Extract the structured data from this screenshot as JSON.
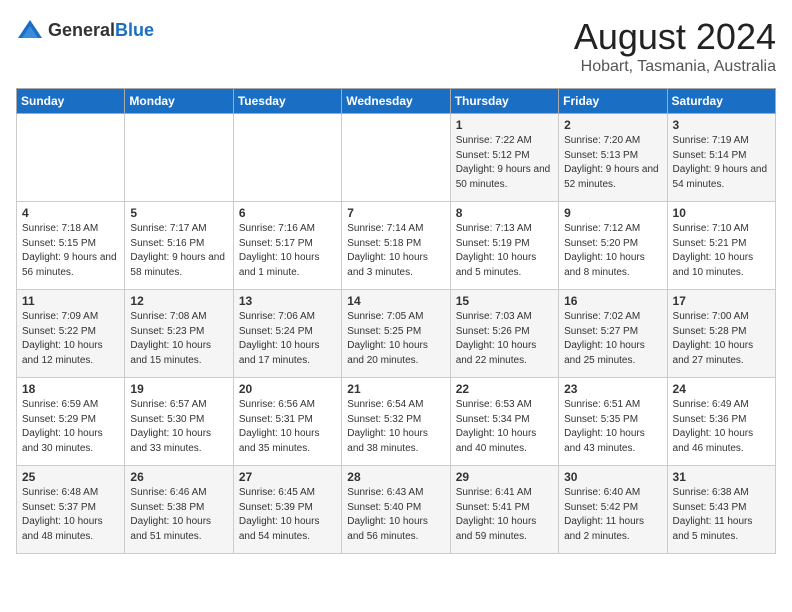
{
  "header": {
    "logo_general": "General",
    "logo_blue": "Blue",
    "title": "August 2024",
    "subtitle": "Hobart, Tasmania, Australia"
  },
  "weekdays": [
    "Sunday",
    "Monday",
    "Tuesday",
    "Wednesday",
    "Thursday",
    "Friday",
    "Saturday"
  ],
  "weeks": [
    [
      {
        "day": "",
        "sunrise": "",
        "sunset": "",
        "daylight": ""
      },
      {
        "day": "",
        "sunrise": "",
        "sunset": "",
        "daylight": ""
      },
      {
        "day": "",
        "sunrise": "",
        "sunset": "",
        "daylight": ""
      },
      {
        "day": "",
        "sunrise": "",
        "sunset": "",
        "daylight": ""
      },
      {
        "day": "1",
        "sunrise": "Sunrise: 7:22 AM",
        "sunset": "Sunset: 5:12 PM",
        "daylight": "Daylight: 9 hours and 50 minutes."
      },
      {
        "day": "2",
        "sunrise": "Sunrise: 7:20 AM",
        "sunset": "Sunset: 5:13 PM",
        "daylight": "Daylight: 9 hours and 52 minutes."
      },
      {
        "day": "3",
        "sunrise": "Sunrise: 7:19 AM",
        "sunset": "Sunset: 5:14 PM",
        "daylight": "Daylight: 9 hours and 54 minutes."
      }
    ],
    [
      {
        "day": "4",
        "sunrise": "Sunrise: 7:18 AM",
        "sunset": "Sunset: 5:15 PM",
        "daylight": "Daylight: 9 hours and 56 minutes."
      },
      {
        "day": "5",
        "sunrise": "Sunrise: 7:17 AM",
        "sunset": "Sunset: 5:16 PM",
        "daylight": "Daylight: 9 hours and 58 minutes."
      },
      {
        "day": "6",
        "sunrise": "Sunrise: 7:16 AM",
        "sunset": "Sunset: 5:17 PM",
        "daylight": "Daylight: 10 hours and 1 minute."
      },
      {
        "day": "7",
        "sunrise": "Sunrise: 7:14 AM",
        "sunset": "Sunset: 5:18 PM",
        "daylight": "Daylight: 10 hours and 3 minutes."
      },
      {
        "day": "8",
        "sunrise": "Sunrise: 7:13 AM",
        "sunset": "Sunset: 5:19 PM",
        "daylight": "Daylight: 10 hours and 5 minutes."
      },
      {
        "day": "9",
        "sunrise": "Sunrise: 7:12 AM",
        "sunset": "Sunset: 5:20 PM",
        "daylight": "Daylight: 10 hours and 8 minutes."
      },
      {
        "day": "10",
        "sunrise": "Sunrise: 7:10 AM",
        "sunset": "Sunset: 5:21 PM",
        "daylight": "Daylight: 10 hours and 10 minutes."
      }
    ],
    [
      {
        "day": "11",
        "sunrise": "Sunrise: 7:09 AM",
        "sunset": "Sunset: 5:22 PM",
        "daylight": "Daylight: 10 hours and 12 minutes."
      },
      {
        "day": "12",
        "sunrise": "Sunrise: 7:08 AM",
        "sunset": "Sunset: 5:23 PM",
        "daylight": "Daylight: 10 hours and 15 minutes."
      },
      {
        "day": "13",
        "sunrise": "Sunrise: 7:06 AM",
        "sunset": "Sunset: 5:24 PM",
        "daylight": "Daylight: 10 hours and 17 minutes."
      },
      {
        "day": "14",
        "sunrise": "Sunrise: 7:05 AM",
        "sunset": "Sunset: 5:25 PM",
        "daylight": "Daylight: 10 hours and 20 minutes."
      },
      {
        "day": "15",
        "sunrise": "Sunrise: 7:03 AM",
        "sunset": "Sunset: 5:26 PM",
        "daylight": "Daylight: 10 hours and 22 minutes."
      },
      {
        "day": "16",
        "sunrise": "Sunrise: 7:02 AM",
        "sunset": "Sunset: 5:27 PM",
        "daylight": "Daylight: 10 hours and 25 minutes."
      },
      {
        "day": "17",
        "sunrise": "Sunrise: 7:00 AM",
        "sunset": "Sunset: 5:28 PM",
        "daylight": "Daylight: 10 hours and 27 minutes."
      }
    ],
    [
      {
        "day": "18",
        "sunrise": "Sunrise: 6:59 AM",
        "sunset": "Sunset: 5:29 PM",
        "daylight": "Daylight: 10 hours and 30 minutes."
      },
      {
        "day": "19",
        "sunrise": "Sunrise: 6:57 AM",
        "sunset": "Sunset: 5:30 PM",
        "daylight": "Daylight: 10 hours and 33 minutes."
      },
      {
        "day": "20",
        "sunrise": "Sunrise: 6:56 AM",
        "sunset": "Sunset: 5:31 PM",
        "daylight": "Daylight: 10 hours and 35 minutes."
      },
      {
        "day": "21",
        "sunrise": "Sunrise: 6:54 AM",
        "sunset": "Sunset: 5:32 PM",
        "daylight": "Daylight: 10 hours and 38 minutes."
      },
      {
        "day": "22",
        "sunrise": "Sunrise: 6:53 AM",
        "sunset": "Sunset: 5:34 PM",
        "daylight": "Daylight: 10 hours and 40 minutes."
      },
      {
        "day": "23",
        "sunrise": "Sunrise: 6:51 AM",
        "sunset": "Sunset: 5:35 PM",
        "daylight": "Daylight: 10 hours and 43 minutes."
      },
      {
        "day": "24",
        "sunrise": "Sunrise: 6:49 AM",
        "sunset": "Sunset: 5:36 PM",
        "daylight": "Daylight: 10 hours and 46 minutes."
      }
    ],
    [
      {
        "day": "25",
        "sunrise": "Sunrise: 6:48 AM",
        "sunset": "Sunset: 5:37 PM",
        "daylight": "Daylight: 10 hours and 48 minutes."
      },
      {
        "day": "26",
        "sunrise": "Sunrise: 6:46 AM",
        "sunset": "Sunset: 5:38 PM",
        "daylight": "Daylight: 10 hours and 51 minutes."
      },
      {
        "day": "27",
        "sunrise": "Sunrise: 6:45 AM",
        "sunset": "Sunset: 5:39 PM",
        "daylight": "Daylight: 10 hours and 54 minutes."
      },
      {
        "day": "28",
        "sunrise": "Sunrise: 6:43 AM",
        "sunset": "Sunset: 5:40 PM",
        "daylight": "Daylight: 10 hours and 56 minutes."
      },
      {
        "day": "29",
        "sunrise": "Sunrise: 6:41 AM",
        "sunset": "Sunset: 5:41 PM",
        "daylight": "Daylight: 10 hours and 59 minutes."
      },
      {
        "day": "30",
        "sunrise": "Sunrise: 6:40 AM",
        "sunset": "Sunset: 5:42 PM",
        "daylight": "Daylight: 11 hours and 2 minutes."
      },
      {
        "day": "31",
        "sunrise": "Sunrise: 6:38 AM",
        "sunset": "Sunset: 5:43 PM",
        "daylight": "Daylight: 11 hours and 5 minutes."
      }
    ]
  ]
}
